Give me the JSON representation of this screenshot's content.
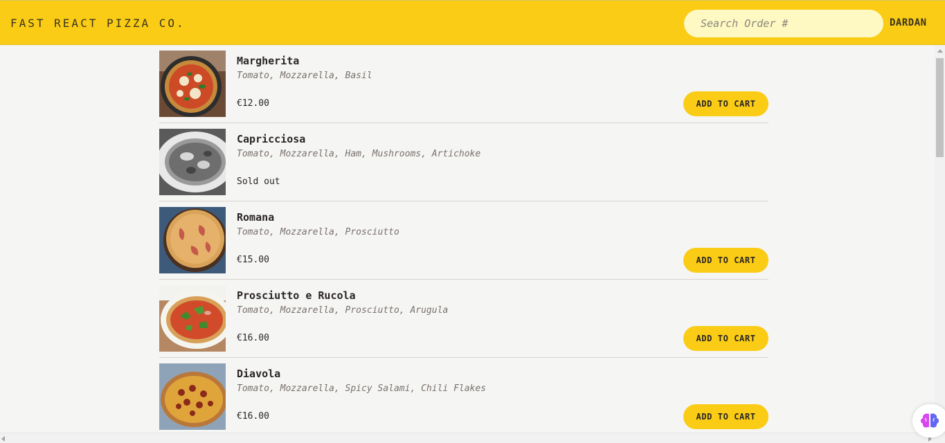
{
  "header": {
    "logo": "Fast React Pizza Co.",
    "search_placeholder": "Search Order #",
    "username": "DARDAN"
  },
  "menu": [
    {
      "name": "Margherita",
      "ingredients": "Tomato, Mozzarella, Basil",
      "price": "€12.00",
      "sold_out": false,
      "button": "Add to cart",
      "image_icon": "pizza-margherita-photo"
    },
    {
      "name": "Capricciosa",
      "ingredients": "Tomato, Mozzarella, Ham, Mushrooms, Artichoke",
      "price": "",
      "sold_out": true,
      "sold_out_label": "Sold out",
      "image_icon": "pizza-capricciosa-photo-grayscale"
    },
    {
      "name": "Romana",
      "ingredients": "Tomato, Mozzarella, Prosciutto",
      "price": "€15.00",
      "sold_out": false,
      "button": "Add to cart",
      "image_icon": "pizza-romana-photo"
    },
    {
      "name": "Prosciutto e Rucola",
      "ingredients": "Tomato, Mozzarella, Prosciutto, Arugula",
      "price": "€16.00",
      "sold_out": false,
      "button": "Add to cart",
      "image_icon": "pizza-prosciutto-rucola-photo"
    },
    {
      "name": "Diavola",
      "ingredients": "Tomato, Mozzarella, Spicy Salami, Chili Flakes",
      "price": "€16.00",
      "sold_out": false,
      "button": "Add to cart",
      "image_icon": "pizza-diavola-photo"
    }
  ],
  "colors": {
    "accent": "#facc15",
    "search_bg": "#fef9c3",
    "page_bg": "#f5f5f4",
    "text": "#292524",
    "muted": "#78716c"
  }
}
